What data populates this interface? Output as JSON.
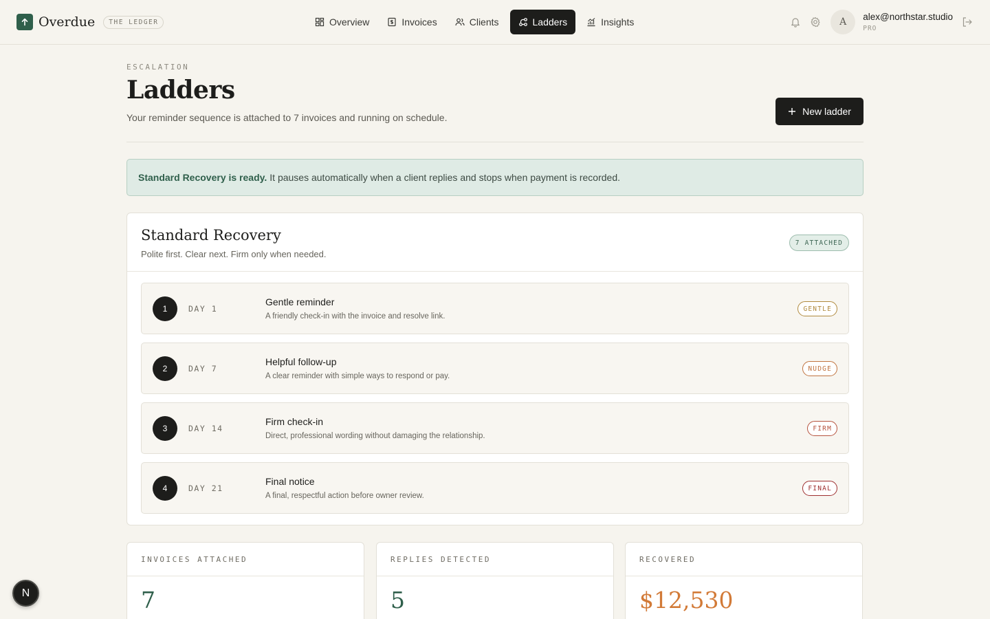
{
  "brand": {
    "name": "Overdue",
    "tag": "THE LEDGER",
    "logo_icon": "arrow-up-icon"
  },
  "nav": [
    {
      "label": "Overview",
      "icon": "grid-icon",
      "active": false
    },
    {
      "label": "Invoices",
      "icon": "receipt-icon",
      "active": false
    },
    {
      "label": "Clients",
      "icon": "users-icon",
      "active": false
    },
    {
      "label": "Ladders",
      "icon": "workflow-icon",
      "active": true
    },
    {
      "label": "Insights",
      "icon": "chart-icon",
      "active": false
    }
  ],
  "user": {
    "initial": "A",
    "email": "alex@northstar.studio",
    "plan": "PRO"
  },
  "header": {
    "eyebrow": "ESCALATION",
    "title": "Ladders",
    "subtitle": "Your reminder sequence is attached to 7 invoices and running on schedule.",
    "new_button": "New ladder"
  },
  "banner": {
    "bold": "Standard Recovery is ready.",
    "text": "It pauses automatically when a client replies and stops when payment is recorded."
  },
  "ladder": {
    "title": "Standard Recovery",
    "subtitle": "Polite first. Clear next. Firm only when needed.",
    "badge": "7 ATTACHED",
    "steps": [
      {
        "num": "1",
        "day": "DAY 1",
        "title": "Gentle reminder",
        "desc": "A friendly check-in with the invoice and resolve link.",
        "tone": "GENTLE",
        "tone_color": "#b08a3e"
      },
      {
        "num": "2",
        "day": "DAY 7",
        "title": "Helpful follow-up",
        "desc": "A clear reminder with simple ways to respond or pay.",
        "tone": "NUDGE",
        "tone_color": "#c0733f"
      },
      {
        "num": "3",
        "day": "DAY 14",
        "title": "Firm check-in",
        "desc": "Direct, professional wording without damaging the relationship.",
        "tone": "FIRM",
        "tone_color": "#b5523d"
      },
      {
        "num": "4",
        "day": "DAY 21",
        "title": "Final notice",
        "desc": "A final, respectful action before owner review.",
        "tone": "FINAL",
        "tone_color": "#9e2f2f"
      }
    ]
  },
  "stats": [
    {
      "label": "INVOICES ATTACHED",
      "value": "7",
      "note": "",
      "color": "#2f5f4b"
    },
    {
      "label": "REPLIES DETECTED",
      "value": "5",
      "note": "",
      "color": "#2f5f4b"
    },
    {
      "label": "RECOVERED",
      "value": "$12,530",
      "note": "",
      "color": "#d27a37"
    }
  ],
  "fab": {
    "label": "N"
  }
}
